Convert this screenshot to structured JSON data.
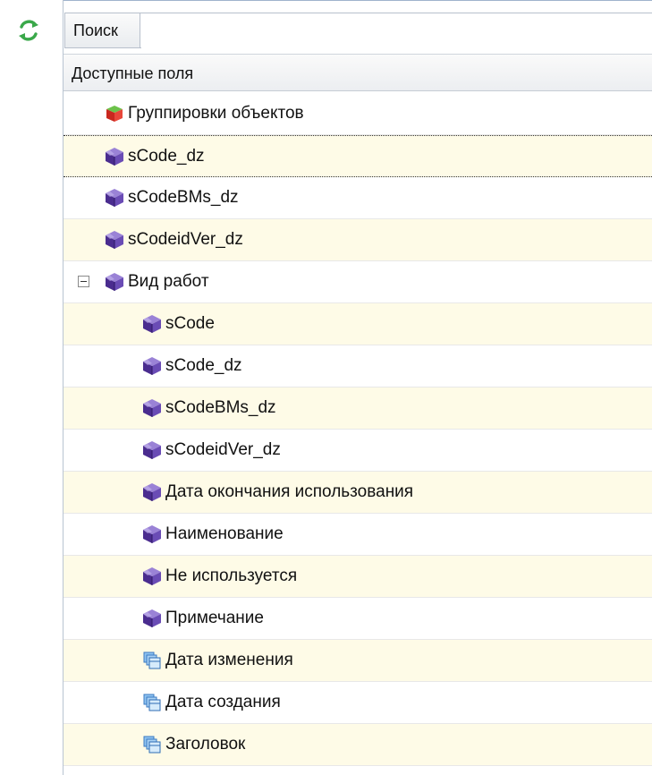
{
  "toolbar": {
    "refresh_icon": "refresh-icon",
    "search_label": "Поиск",
    "search_value": ""
  },
  "panel": {
    "header": "Доступные поля"
  },
  "tree": {
    "items": [
      {
        "label": "Группировки объектов",
        "icon": "grouping-cube-icon",
        "level": 1
      },
      {
        "label": "sCode_dz",
        "icon": "field-cube-icon",
        "level": 1,
        "selected": true
      },
      {
        "label": "sCodeBMs_dz",
        "icon": "field-cube-icon",
        "level": 1
      },
      {
        "label": "sCodeidVer_dz",
        "icon": "field-cube-icon",
        "level": 1
      },
      {
        "label": "Вид работ",
        "icon": "field-cube-icon",
        "level": 1,
        "expanded": true
      },
      {
        "label": "sCode",
        "icon": "field-cube-icon",
        "level": 2
      },
      {
        "label": "sCode_dz",
        "icon": "field-cube-icon",
        "level": 2
      },
      {
        "label": "sCodeBMs_dz",
        "icon": "field-cube-icon",
        "level": 2
      },
      {
        "label": "sCodeidVer_dz",
        "icon": "field-cube-icon",
        "level": 2
      },
      {
        "label": "Дата окончания использования",
        "icon": "field-cube-icon",
        "level": 2
      },
      {
        "label": "Наименование",
        "icon": "field-cube-icon",
        "level": 2
      },
      {
        "label": "Не используется",
        "icon": "field-cube-icon",
        "level": 2
      },
      {
        "label": "Примечание",
        "icon": "field-cube-icon",
        "level": 2
      },
      {
        "label": "Дата изменения",
        "icon": "table-field-icon",
        "level": 2
      },
      {
        "label": "Дата создания",
        "icon": "table-field-icon",
        "level": 2
      },
      {
        "label": "Заголовок",
        "icon": "table-field-icon",
        "level": 2
      }
    ]
  },
  "colors": {
    "row_alt": "#fefbe7",
    "row_plain": "#ffffff",
    "cube_purple": "#5b3aa0",
    "group_red": "#d8342a",
    "table_blue": "#4a8fd6",
    "refresh_green": "#3aa84a"
  }
}
